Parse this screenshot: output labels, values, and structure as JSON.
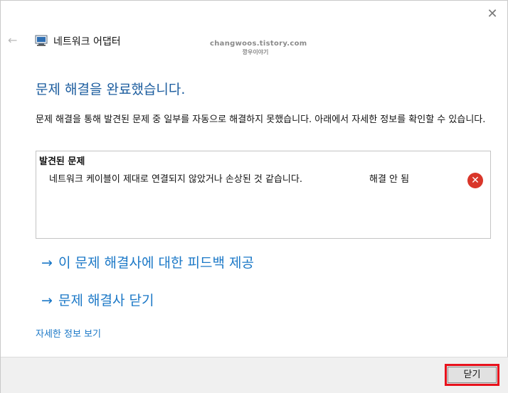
{
  "window": {
    "title": "네트워크 어댑터",
    "close_icon_glyph": "✕",
    "back_icon_glyph": "←"
  },
  "watermark": {
    "line1": "changwoos.tistory.com",
    "line2": "깡우이야기"
  },
  "main": {
    "headline": "문제 해결을 완료했습니다.",
    "description": "문제 해결을 통해 발견된 문제 중 일부를 자동으로 해결하지 못했습니다. 아래에서 자세한 정보를 확인할 수 있습니다.",
    "problems": {
      "header": "발견된 문제",
      "items": [
        {
          "text": "네트워크 케이블이 제대로 연결되지 않았거나 손상된 것 같습니다.",
          "status": "해결 안 됨",
          "status_icon": "error-icon"
        }
      ]
    },
    "links": {
      "arrow": "→",
      "feedback": "이 문제 해결사에 대한 피드백 제공",
      "close_troubleshooter": "문제 해결사 닫기"
    },
    "details_link": "자세한 정보 보기"
  },
  "footer": {
    "close_button": "닫기"
  },
  "colors": {
    "headline": "#1b5c9e",
    "link": "#1b78c7",
    "error": "#d9362a",
    "highlight": "#e8121c"
  }
}
